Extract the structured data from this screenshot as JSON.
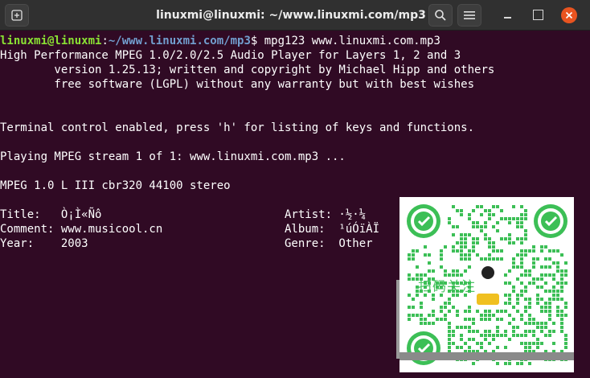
{
  "window": {
    "title": "linuxmi@linuxmi: ~/www.linuxmi.com/mp3"
  },
  "icons": {
    "new_tab": "new-tab-icon",
    "search": "search-icon",
    "menu": "hamburger-menu-icon",
    "minimize": "minimize-icon",
    "maximize": "maximize-icon",
    "close": "close-icon"
  },
  "colors": {
    "terminal_bg": "#300a24",
    "prompt_user": "#8ae234",
    "prompt_path": "#729fcf",
    "text": "#ffffff",
    "close_button": "#e95420",
    "qr_green": "#3cbf56"
  },
  "terminal": {
    "prompt_user": "linuxmi@linuxmi",
    "prompt_sep": ":",
    "prompt_path": "~/www.linuxmi.com/mp3",
    "prompt_symbol": "$ ",
    "command": "mpg123 www.linuxmi.com.mp3",
    "lines": [
      "High Performance MPEG 1.0/2.0/2.5 Audio Player for Layers 1, 2 and 3",
      "        version 1.25.13; written and copyright by Michael Hipp and others",
      "        free software (LGPL) without any warranty but with best wishes",
      "",
      "",
      "Terminal control enabled, press 'h' for listing of keys and functions.",
      "",
      "Playing MPEG stream 1 of 1: www.linuxmi.com.mp3 ...",
      "",
      "MPEG 1.0 L III cbr320 44100 stereo",
      "",
      "Title:   Ò¡Ì«Ñô                           Artist: ·½·¼",
      "Comment: www.musicool.cn                  Album:  ¹úÓïÀÏ",
      "Year:    2003                             Genre:  Other"
    ]
  },
  "overlay": {
    "banner_text": "扫码关注"
  }
}
